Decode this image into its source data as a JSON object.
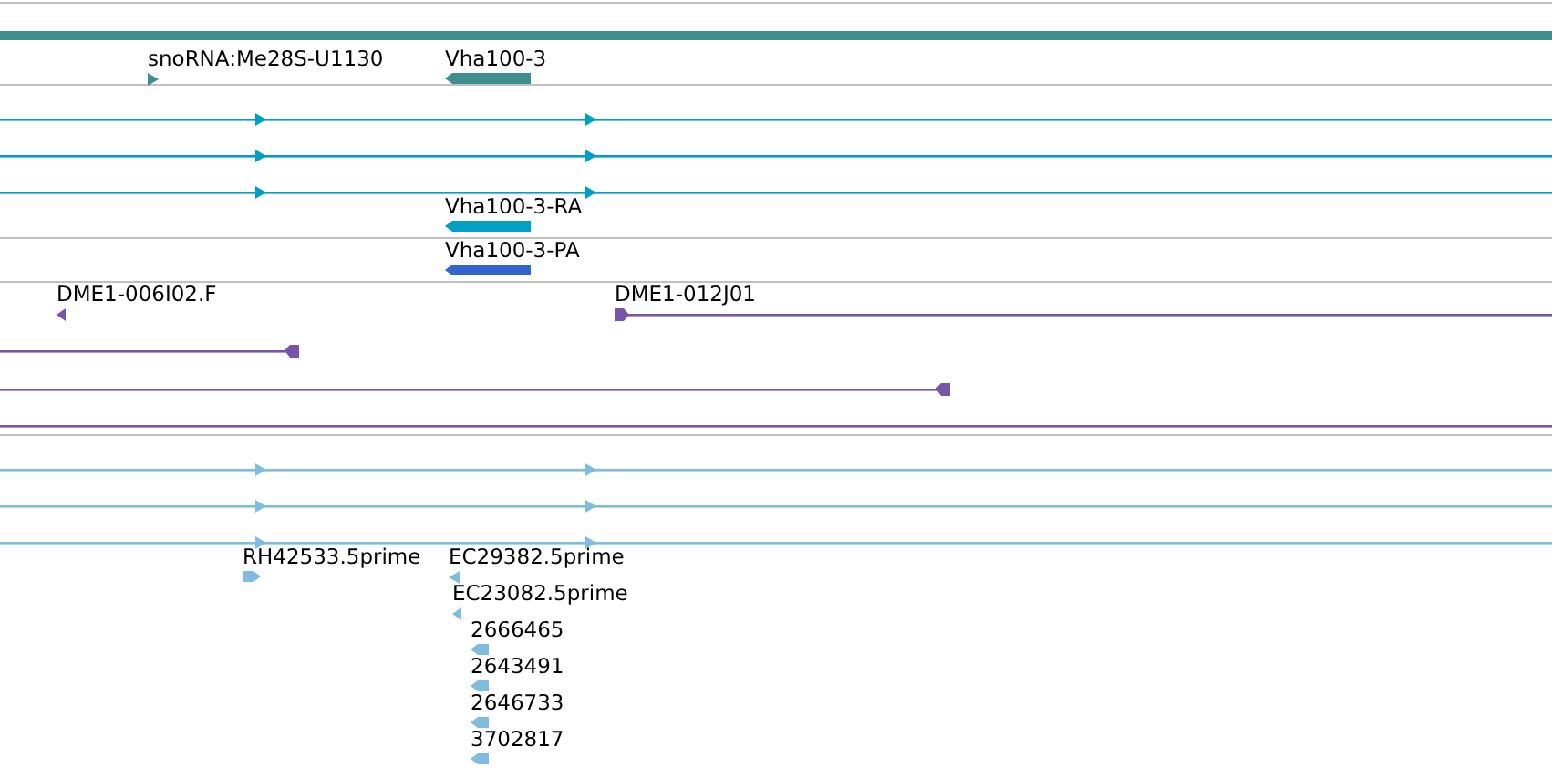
{
  "tracks": [
    {
      "color": "#3f8f91",
      "features": [
        {
          "kind": "span"
        },
        {
          "kind": "marker",
          "label": "snoRNA:Me28S-U1130",
          "reverse": false
        },
        {
          "kind": "block",
          "label": "Vha100-3",
          "reverse": true
        }
      ]
    },
    {
      "color": "#00a0c4",
      "features": [
        {
          "kind": "line",
          "reverse": false
        },
        {
          "kind": "line",
          "reverse": false
        },
        {
          "kind": "line",
          "reverse": false
        },
        {
          "kind": "block",
          "label": "Vha100-3-RA",
          "reverse": true
        }
      ]
    },
    {
      "color": "#3366cc",
      "features": [
        {
          "kind": "block",
          "label": "Vha100-3-PA",
          "reverse": true
        }
      ]
    },
    {
      "color": "#7755aa",
      "features": [
        {
          "kind": "marker",
          "label": "DME1-006I02.F",
          "reverse": true
        },
        {
          "kind": "line",
          "label": "DME1-012J01",
          "reverse": false
        },
        {
          "kind": "line",
          "reverse": true
        },
        {
          "kind": "line",
          "reverse": true
        },
        {
          "kind": "line"
        }
      ]
    },
    {
      "color": "#80bce0",
      "features": [
        {
          "kind": "line",
          "reverse": false
        },
        {
          "kind": "line",
          "reverse": false
        },
        {
          "kind": "line",
          "reverse": false
        },
        {
          "kind": "block",
          "label": "RH42533.5prime",
          "reverse": false
        },
        {
          "kind": "marker",
          "label": "EC29382.5prime",
          "reverse": true
        },
        {
          "kind": "marker",
          "label": "EC23082.5prime",
          "reverse": true
        },
        {
          "kind": "block",
          "label": "2666465",
          "reverse": true
        },
        {
          "kind": "block",
          "label": "2643491",
          "reverse": true
        },
        {
          "kind": "block",
          "label": "2646733",
          "reverse": true
        },
        {
          "kind": "block",
          "label": "3702817",
          "reverse": true
        }
      ]
    }
  ]
}
